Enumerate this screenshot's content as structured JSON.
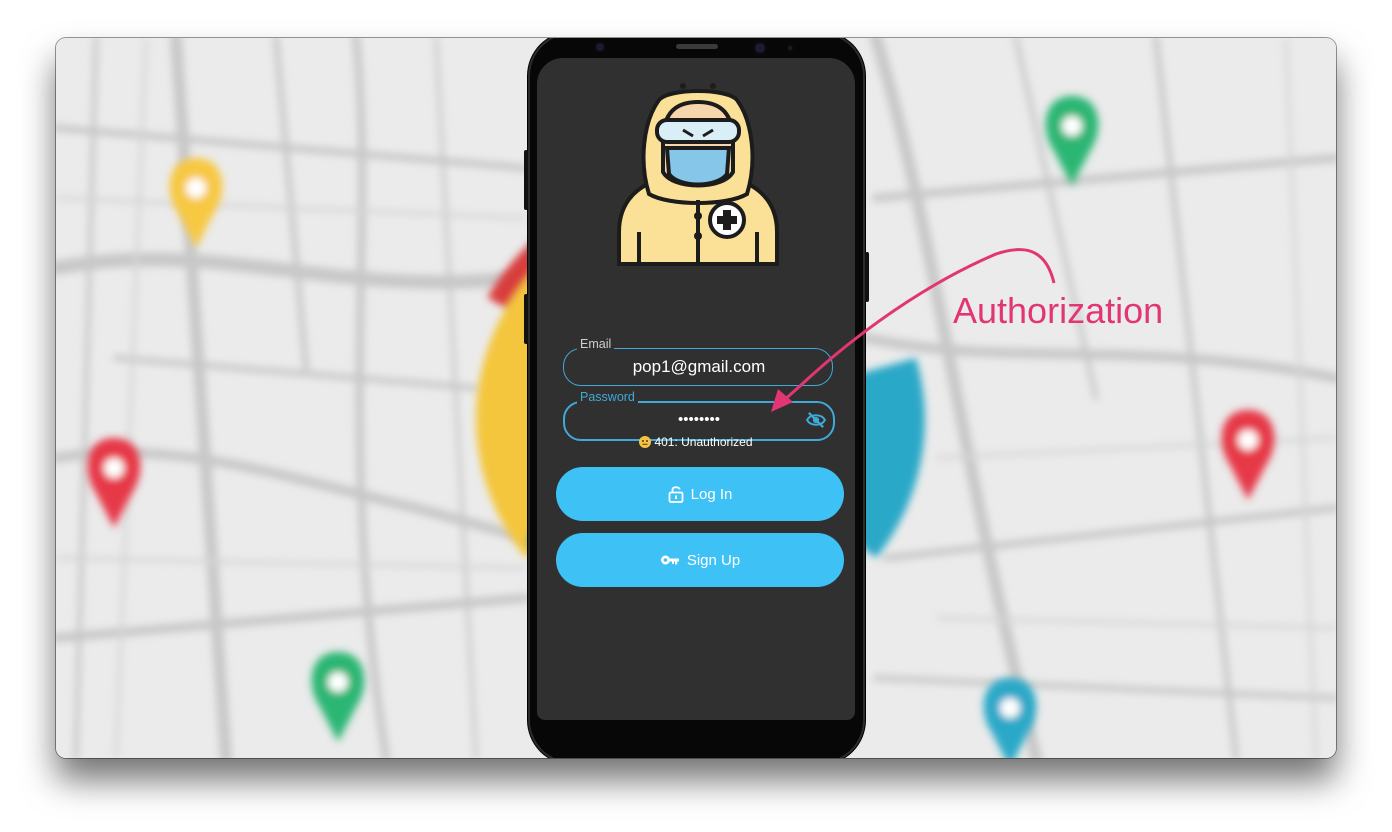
{
  "annotation": {
    "text": "Authorization",
    "color": "#e23574"
  },
  "login": {
    "email": {
      "label": "Email",
      "value": "pop1@gmail.com",
      "label_color": "#cfcfcf"
    },
    "password": {
      "label": "Password",
      "value": "••••••••",
      "label_color": "#3fa9d8",
      "toggle_icon": "eye-off-icon"
    },
    "error": {
      "emoji": "neutral-face-icon",
      "text": "401: Unauthorized"
    },
    "buttons": [
      {
        "label": "Log In",
        "icon": "lock-open-icon"
      },
      {
        "label": "Sign Up",
        "icon": "key-icon"
      }
    ],
    "accent": "#3ec1f5",
    "screen_bg": "#303030"
  },
  "map_pins": {
    "colors": [
      "#f7c843",
      "#e63946",
      "#2bb673",
      "#f7c843",
      "#2aa8c8"
    ]
  }
}
